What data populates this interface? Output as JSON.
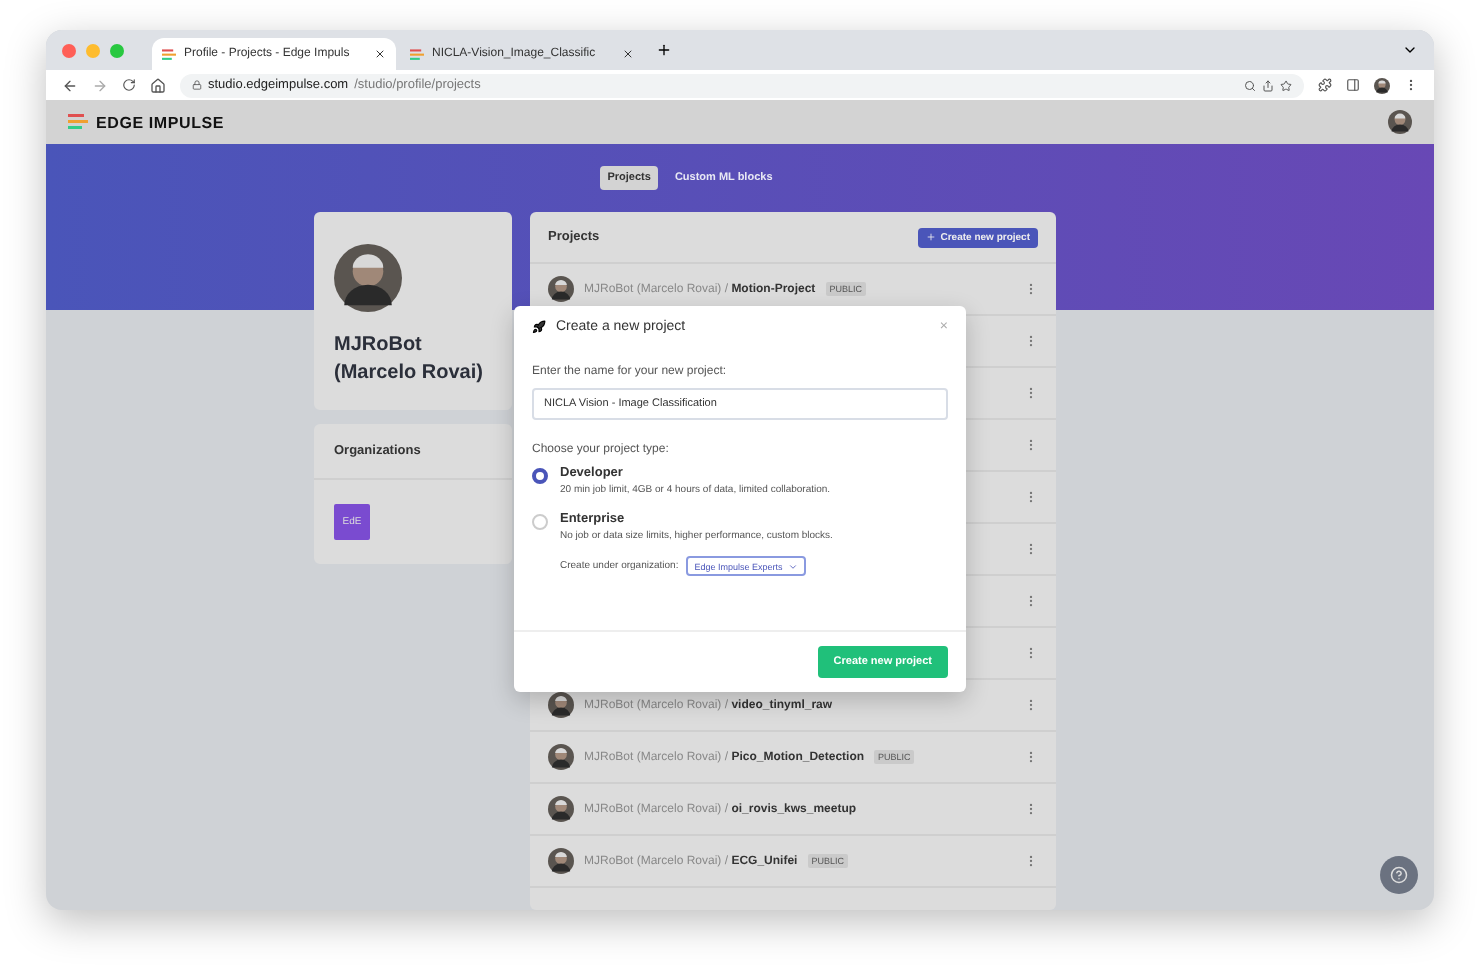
{
  "browser": {
    "tabs": [
      {
        "title": "Profile - Projects - Edge Impuls",
        "selected": true
      },
      {
        "title": "NICLA-Vision_Image_Classific",
        "selected": false
      }
    ],
    "address": {
      "host": "studio.edgeimpulse.com",
      "path": "/studio/profile/projects"
    }
  },
  "app": {
    "logo": "EDGE IMPULSE"
  },
  "nav": [
    {
      "label": "Projects",
      "selected": true
    },
    {
      "label": "Custom ML blocks",
      "selected": false
    }
  ],
  "profile": {
    "name": "MJRoBot (Marcelo Rovai)"
  },
  "organizations": {
    "title": "Organizations",
    "items": [
      {
        "initials": "EdE"
      }
    ]
  },
  "projects": {
    "title": "Projects",
    "create_button": "Create new project",
    "rows": [
      {
        "label": "MJRoBot (Marcelo Rovai) / **Motion-Project**",
        "badge": "PUBLIC"
      },
      {},
      {},
      {},
      {},
      {},
      {},
      {},
      {
        "label": "MJRoBot (Marcelo Rovai) / **video_tinyml_raw**"
      },
      {
        "label": "MJRoBot (Marcelo Rovai) / **Pico_Motion_Detection**",
        "badge": "PUBLIC"
      },
      {
        "label": "MJRoBot (Marcelo Rovai) / **oi_rovis_kws_meetup**"
      },
      {
        "label": "MJRoBot (Marcelo Rovai) / **ECG_Unifei**",
        "badge": "PUBLIC"
      }
    ]
  },
  "dialog": {
    "title": "Create a new project",
    "close": "×",
    "name_label": "Enter the name for your new project:",
    "name_value": "NICLA Vision - Image Classification",
    "type_label": "Choose your project type:",
    "types": [
      {
        "title": "Developer",
        "description": "20 min job limit, 4GB or 4 hours of data, limited collaboration.",
        "selected": true
      },
      {
        "title": "Enterprise",
        "description": "No job or data size limits, higher performance, custom blocks.",
        "selected": false,
        "org_label": "Create under organization:",
        "org_value": "Edge Impulse Experts"
      }
    ],
    "submit": "Create new project"
  }
}
